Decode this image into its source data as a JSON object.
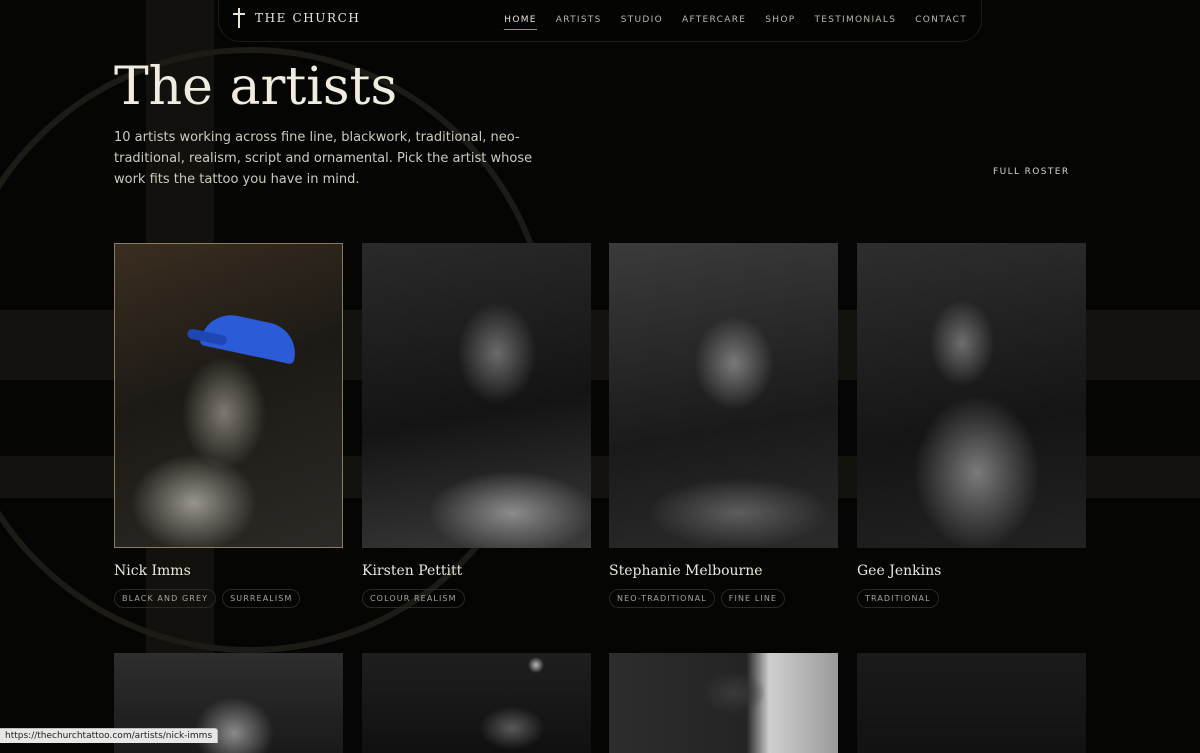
{
  "nav": {
    "brand": "THE CHURCH",
    "items": [
      {
        "label": "HOME",
        "active": true
      },
      {
        "label": "ARTISTS"
      },
      {
        "label": "STUDIO"
      },
      {
        "label": "AFTERCARE"
      },
      {
        "label": "SHOP"
      },
      {
        "label": "TESTIMONIALS"
      },
      {
        "label": "CONTACT"
      }
    ]
  },
  "hero": {
    "title": "The artists",
    "intro": "10 artists working across fine line, blackwork, traditional, neo-traditional, realism, script and ornamental. Pick the artist whose work fits the tattoo you have in mind.",
    "roster_link": "FULL ROSTER"
  },
  "artists": [
    {
      "name": "Nick Imms",
      "tags": [
        "BLACK AND GREY",
        "SURREALISM"
      ]
    },
    {
      "name": "Kirsten Pettitt",
      "tags": [
        "COLOUR REALISM"
      ]
    },
    {
      "name": "Stephanie Melbourne",
      "tags": [
        "NEO-TRADITIONAL",
        "FINE LINE"
      ]
    },
    {
      "name": "Gee Jenkins",
      "tags": [
        "TRADITIONAL"
      ]
    }
  ],
  "status_url": "https://thechurchtattoo.com/artists/nick-imms",
  "colors": {
    "background": "#050504",
    "text": "#e9e4d8",
    "accent": "#9c8f66",
    "cap_blue": "#2b5bd6"
  }
}
